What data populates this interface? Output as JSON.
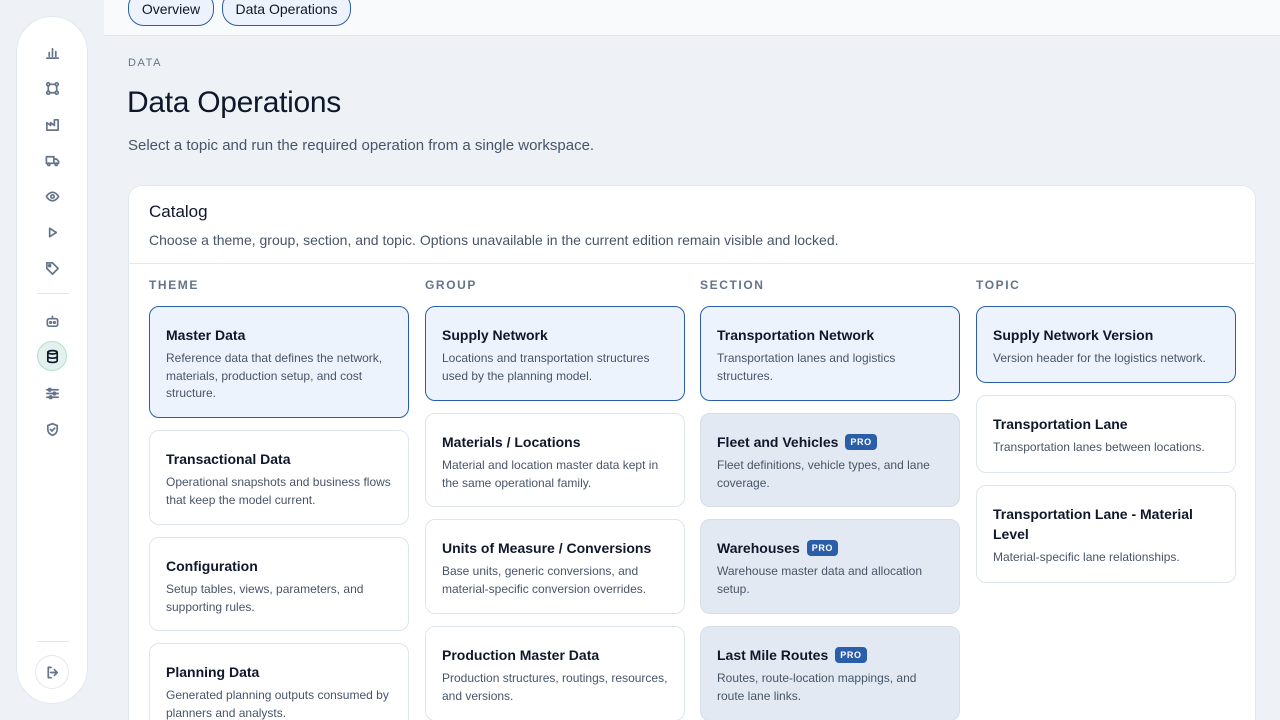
{
  "nav": {
    "tabs": [
      {
        "label": "Overview"
      },
      {
        "label": "Data Operations"
      }
    ]
  },
  "sidebar": {
    "icons": [
      "bar-chart-icon",
      "workflow-icon",
      "factory-icon",
      "truck-icon",
      "eye-icon",
      "play-icon",
      "tag-icon",
      "bot-icon",
      "database-icon",
      "sliders-icon",
      "shield-icon"
    ],
    "active": "database-icon",
    "logout_icon": "logout-icon"
  },
  "header": {
    "eyebrow": "DATA",
    "title": "Data Operations",
    "subtitle": "Select a topic and run the required operation from a single workspace."
  },
  "catalog": {
    "title": "Catalog",
    "description": "Choose a theme, group, section, and topic. Options unavailable in the current edition remain visible and locked.",
    "badge": "PRO",
    "columns": [
      {
        "label": "THEME",
        "items": [
          {
            "title": "Master Data",
            "desc": "Reference data that defines the network, materials, production setup, and cost structure."
          },
          {
            "title": "Transactional Data",
            "desc": "Operational snapshots and business flows that keep the model current."
          },
          {
            "title": "Configuration",
            "desc": "Setup tables, views, parameters, and supporting rules."
          },
          {
            "title": "Planning Data",
            "desc": "Generated planning outputs consumed by planners and analysts."
          }
        ]
      },
      {
        "label": "GROUP",
        "items": [
          {
            "title": "Supply Network",
            "desc": "Locations and transportation structures used by the planning model."
          },
          {
            "title": "Materials / Locations",
            "desc": "Material and location master data kept in the same operational family."
          },
          {
            "title": "Units of Measure / Conversions",
            "desc": "Base units, generic conversions, and material-specific conversion overrides."
          },
          {
            "title": "Production Master Data",
            "desc": "Production structures, routings, resources, and versions."
          }
        ]
      },
      {
        "label": "SECTION",
        "items": [
          {
            "title": "Transportation Network",
            "desc": "Transportation lanes and logistics structures."
          },
          {
            "title": "Fleet and Vehicles",
            "desc": "Fleet definitions, vehicle types, and lane coverage."
          },
          {
            "title": "Warehouses",
            "desc": "Warehouse master data and allocation setup."
          },
          {
            "title": "Last Mile Routes",
            "desc": "Routes, route-location mappings, and route lane links."
          }
        ]
      },
      {
        "label": "TOPIC",
        "items": [
          {
            "title": "Supply Network Version",
            "desc": "Version header for the logistics network."
          },
          {
            "title": "Transportation Lane",
            "desc": "Transportation lanes between locations."
          },
          {
            "title": "Transportation Lane - Material Level",
            "desc": "Material-specific lane relationships."
          }
        ]
      }
    ]
  }
}
